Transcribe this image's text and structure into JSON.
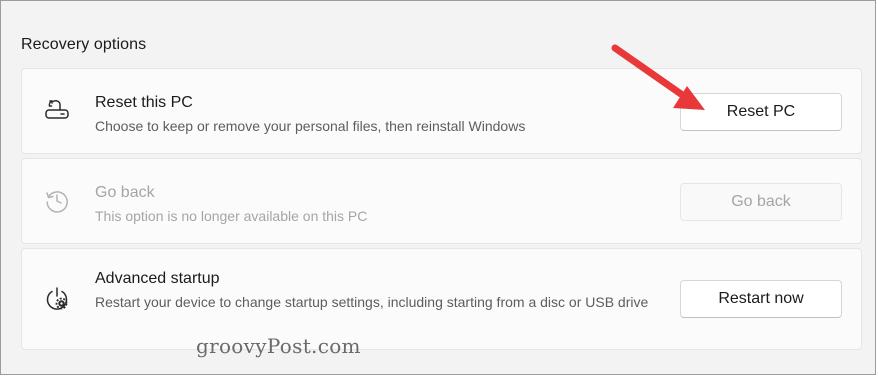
{
  "section": {
    "title": "Recovery options"
  },
  "options": [
    {
      "title": "Reset this PC",
      "description": "Choose to keep or remove your personal files, then reinstall Windows",
      "button_label": "Reset PC",
      "icon": "reset-pc-icon",
      "enabled": true
    },
    {
      "title": "Go back",
      "description": "This option is no longer available on this PC",
      "button_label": "Go back",
      "icon": "history-icon",
      "enabled": false
    },
    {
      "title": "Advanced startup",
      "description": "Restart your device to change startup settings, including starting from a disc or USB drive",
      "button_label": "Restart now",
      "icon": "advanced-startup-icon",
      "enabled": true
    }
  ],
  "annotation": {
    "arrow_color": "#e8383a"
  },
  "watermark": {
    "text": "groovyPost.com"
  }
}
